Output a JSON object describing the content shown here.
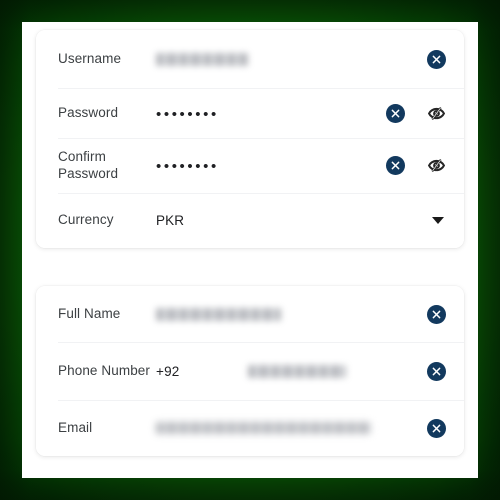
{
  "theme": {
    "glow_color": "#1e9114",
    "glow_edge_color": "#042d05",
    "panel_bg": "#ffffff",
    "accent_dark": "#12395e",
    "label_color": "#3c4043",
    "value_color": "#202124",
    "divider_color": "#f1f2f4"
  },
  "cards": [
    {
      "id": "account-card",
      "rows": [
        {
          "key": "username",
          "label": "Username",
          "value": "",
          "value_state": "redacted-blurred",
          "actions": [
            "clear-icon"
          ]
        },
        {
          "key": "password",
          "label": "Password",
          "value": "••••••••",
          "value_state": "masked",
          "mask_dot_count": 8,
          "actions": [
            "clear-icon",
            "eye-off-icon"
          ]
        },
        {
          "key": "confirm-password",
          "label": "Confirm Password",
          "value": "••••••••",
          "value_state": "masked",
          "mask_dot_count": 8,
          "actions": [
            "clear-icon",
            "eye-off-icon"
          ]
        },
        {
          "key": "currency",
          "label": "Currency",
          "value": "PKR",
          "value_state": "text",
          "actions": [
            "chevron-down-icon"
          ]
        }
      ]
    },
    {
      "id": "profile-card",
      "rows": [
        {
          "key": "full-name",
          "label": "Full Name",
          "value": "",
          "value_state": "redacted-blurred",
          "actions": [
            "clear-icon"
          ]
        },
        {
          "key": "phone-number",
          "label": "Phone Number",
          "prefix": "+92",
          "value": "",
          "value_state": "redacted-blurred",
          "actions": [
            "clear-icon"
          ]
        },
        {
          "key": "email",
          "label": "Email",
          "value": "",
          "value_state": "redacted-blurred",
          "actions": [
            "clear-icon"
          ]
        }
      ]
    }
  ]
}
